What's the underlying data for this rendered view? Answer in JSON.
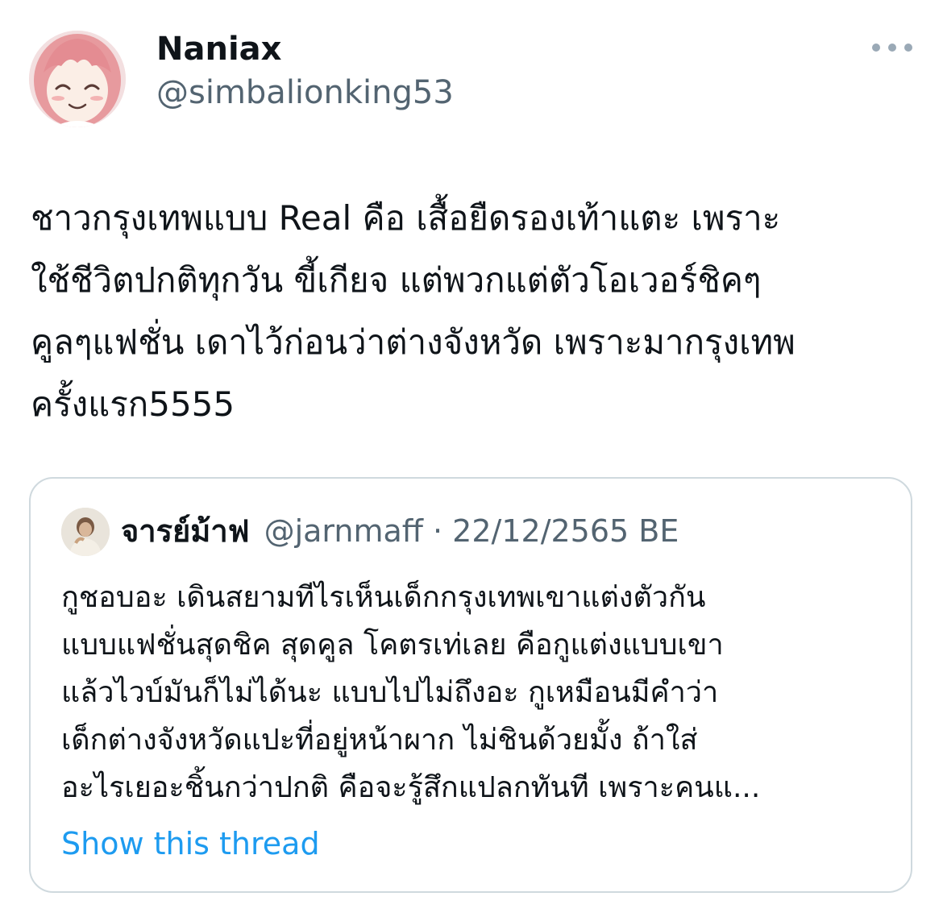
{
  "author": {
    "display_name": "Naniax",
    "handle": "@simbalionking53",
    "avatar_icon": "anime-girl-avatar"
  },
  "tweet": {
    "lines": [
      "ชาวกรุงเทพแบบ Real คือ เสื้อยืดรองเท้าแตะ เพราะ",
      "ใช้ชีวิตปกติทุกวัน ขี้เกียจ แต่พวกแต่ตัวโอเวอร์ชิคๆ",
      "คูลๆแฟชั่น เดาไว้ก่อนว่าต่างจังหวัด เพราะมากรุงเทพ",
      "ครั้งแรก5555"
    ]
  },
  "quote": {
    "author_name": "จารย์ม้าฟ",
    "meta": "@jarnmaff · 22/12/2565 BE",
    "avatar_icon": "user-photo-avatar",
    "lines": [
      "กูชอบอะ เดินสยามทีไรเห็นเด็กกรุงเทพเขาแต่งตัวกัน",
      "แบบแฟชั่นสุดชิค สุดคูล โคตรเท่เลย คือกูแต่งแบบเขา",
      "แล้วไวบ์มันก็ไม่ได้นะ แบบไปไม่ถึงอะ กูเหมือนมีคำว่า",
      "เด็กต่างจังหวัดแปะที่อยู่หน้าผาก ไม่ชินด้วยมั้ง ถ้าใส่",
      "อะไรเยอะชิ้นกว่าปกติ คือจะรู้สึกแปลกทันที เพราะคนแ..."
    ],
    "show_thread_label": "Show this thread"
  },
  "colors": {
    "text": "#0f1419",
    "secondary": "#536471",
    "link": "#1d9bf0",
    "border": "#cfd9de"
  },
  "icons": {
    "more": "more-options-icon"
  }
}
